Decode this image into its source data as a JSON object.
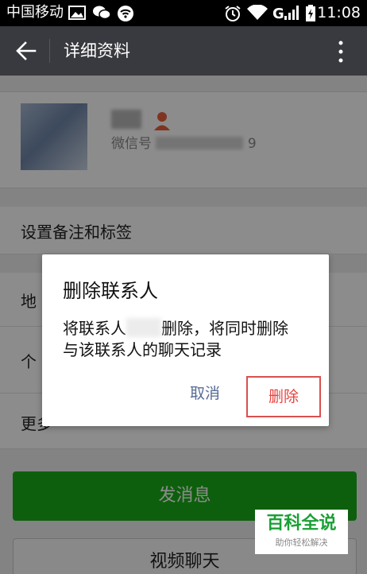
{
  "status_bar": {
    "carrier": "中国移动",
    "time": "11:08",
    "icons": [
      "image-icon",
      "wechat-icon",
      "wifi-icon",
      "alarm-icon",
      "wifi-icon",
      "signal-icon",
      "battery-charging-icon"
    ]
  },
  "app_bar": {
    "title": "详细资料"
  },
  "profile": {
    "wechat_id_label": "微信号",
    "wechat_id_suffix": "9"
  },
  "rows": {
    "remark_tags": "设置备注和标签",
    "region_partial": "地",
    "personal_partial": "个",
    "more_partial": "更多"
  },
  "buttons": {
    "send_message": "发消息",
    "video_call": "视频聊天"
  },
  "dialog": {
    "title": "删除联系人",
    "body_prefix": "将联系人",
    "body_suffix": "删除，将同时删除",
    "body_line2": "与该联系人的聊天记录",
    "cancel": "取消",
    "delete": "删除"
  },
  "watermark": {
    "title": "百科全说",
    "subtitle": "助你轻松解决"
  },
  "colors": {
    "status_bar": "#000000",
    "app_bar": "#393a3f",
    "send_button": "#1aad19",
    "cancel_text": "#576b95",
    "delete_text": "#e64340",
    "highlight_box": "#d9504f"
  }
}
